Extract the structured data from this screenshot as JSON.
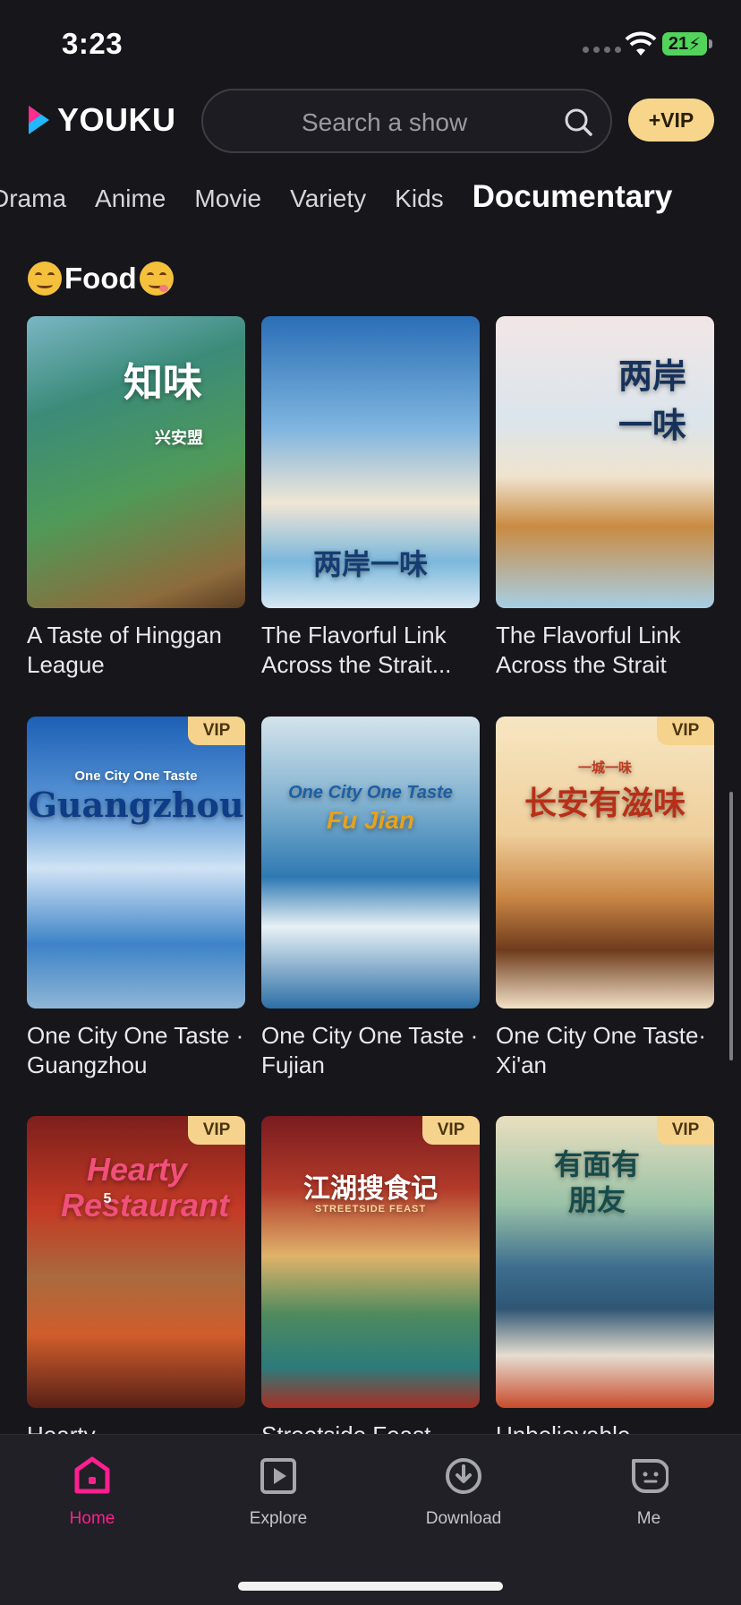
{
  "status": {
    "time": "3:23",
    "battery": "21"
  },
  "header": {
    "logo_text": "YOUKU",
    "search_placeholder": "Search a show",
    "vip_label": "+VIP"
  },
  "tabs": [
    {
      "label": "Drama"
    },
    {
      "label": "Anime"
    },
    {
      "label": "Movie"
    },
    {
      "label": "Variety"
    },
    {
      "label": "Kids"
    },
    {
      "label": "Documentary",
      "active": true
    }
  ],
  "section": {
    "title": "Food"
  },
  "items": [
    {
      "title": "A Taste of Hinggan League",
      "vip": false,
      "poster_text": "知味",
      "poster_subtext": "兴安盟"
    },
    {
      "title": "The Flavorful Link Across the Strait...",
      "vip": false,
      "poster_text": "两岸一味",
      "poster_subtext": ""
    },
    {
      "title": "The Flavorful Link Across the Strait",
      "vip": false,
      "poster_text": "两岸一味",
      "poster_subtext": ""
    },
    {
      "title": "One City One Taste · Guangzhou",
      "vip": true,
      "vip_label": "VIP",
      "poster_text": "Guangzhou",
      "poster_subtext": "One City One Taste"
    },
    {
      "title": "One City One Taste · Fujian",
      "vip": false,
      "poster_text": "Fu Jian",
      "poster_subtext": "One City One Taste"
    },
    {
      "title": "One City One Taste· Xi'an",
      "vip": true,
      "vip_label": "VIP",
      "poster_text": "长安有滋味",
      "poster_subtext": "一城一味"
    },
    {
      "title": "Hearty",
      "vip": true,
      "vip_label": "VIP",
      "poster_text": "Hearty Restaurant",
      "poster_subtext": "5"
    },
    {
      "title": "Streetside Feast",
      "vip": true,
      "vip_label": "VIP",
      "poster_text": "江湖搜食记",
      "poster_subtext": "STREETSIDE FEAST"
    },
    {
      "title": "Unbelievable",
      "vip": true,
      "vip_label": "VIP",
      "poster_text": "有面有朋友",
      "poster_subtext": ""
    }
  ],
  "nav": [
    {
      "label": "Home",
      "icon": "home-icon",
      "active": true
    },
    {
      "label": "Explore",
      "icon": "explore-icon"
    },
    {
      "label": "Download",
      "icon": "download-icon"
    },
    {
      "label": "Me",
      "icon": "me-icon"
    }
  ],
  "colors": {
    "background": "#16161b",
    "accent": "#ff1f8f",
    "vip": "#f6d38c"
  }
}
